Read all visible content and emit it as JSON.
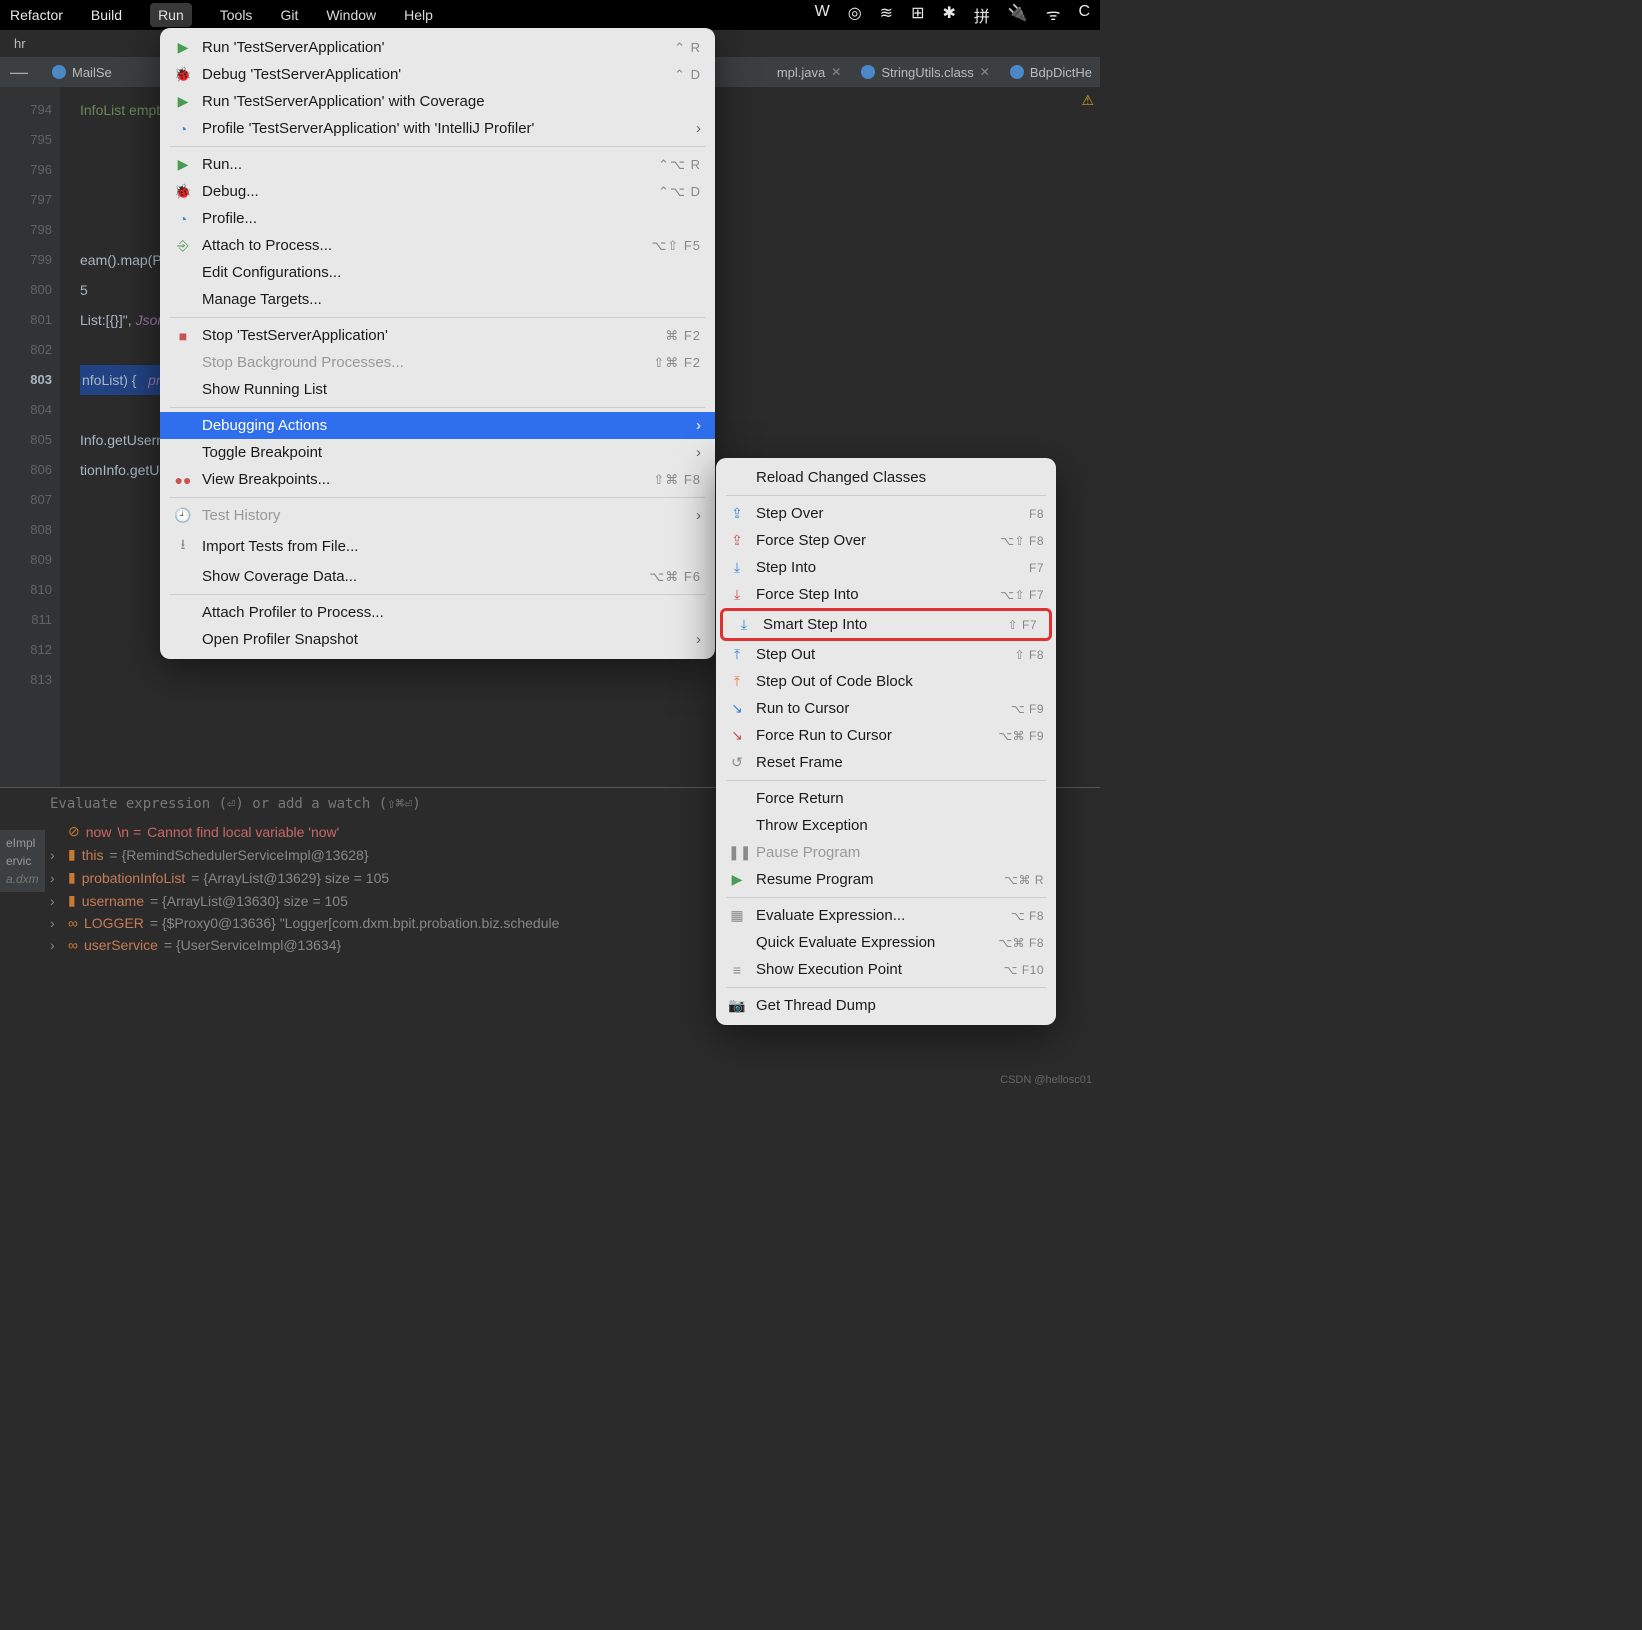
{
  "menubar": {
    "items": [
      "Refactor",
      "Build",
      "Run",
      "Tools",
      "Git",
      "Window",
      "Help"
    ],
    "active_index": 2,
    "tray": [
      "W",
      "◎",
      "≋",
      "⊞",
      "✱",
      "拼",
      "🔌",
      "ᯤ",
      "C"
    ]
  },
  "breadcrumb": "hr",
  "tabs": [
    {
      "label": "MailSe"
    },
    {
      "label": "mpl.java"
    },
    {
      "label": "StringUtils.class"
    },
    {
      "label": "BdpDictHe"
    }
  ],
  "gutter": {
    "start": 794,
    "end": 813,
    "breakpoint_line": 801,
    "current_line": 803
  },
  "code_lines": [
    "InfoList empty\");",
    "",
    "",
    "",
    "",
    "eam().map(ProbationInfo::getUsername",
    "5",
    "List:[{}]\", JsonUtil.toJson(username",
    "",
    "nfoList) {   probationInfoList:  siz",
    "",
    "Info.getUsername())) {",
    "tionInfo.getUsername());",
    "",
    "",
    "",
    "",
    "",
    "",
    ""
  ],
  "run_menu": [
    {
      "icon": "▶",
      "icon_cls": "ic-green",
      "label": "Run 'TestServerApplication'",
      "shortcut": "⌃ R"
    },
    {
      "icon": "🐞",
      "icon_cls": "ic-green",
      "label": "Debug 'TestServerApplication'",
      "shortcut": "⌃ D"
    },
    {
      "icon": "▶",
      "icon_cls": "ic-green",
      "label": "Run 'TestServerApplication' with Coverage",
      "shortcut": ""
    },
    {
      "icon": "◔",
      "icon_cls": "ic-blue",
      "label": "Profile 'TestServerApplication' with 'IntelliJ Profiler'",
      "shortcut": "",
      "arrow": true
    },
    {
      "sep": true
    },
    {
      "icon": "▶",
      "icon_cls": "ic-green",
      "label": "Run...",
      "shortcut": "⌃⌥ R"
    },
    {
      "icon": "🐞",
      "icon_cls": "ic-green",
      "label": "Debug...",
      "shortcut": "⌃⌥ D"
    },
    {
      "icon": "◔",
      "icon_cls": "ic-blue",
      "label": "Profile...",
      "shortcut": ""
    },
    {
      "icon": "⎆",
      "icon_cls": "ic-green",
      "label": "Attach to Process...",
      "shortcut": "⌥⇧ F5"
    },
    {
      "icon": "",
      "label": "Edit Configurations...",
      "shortcut": ""
    },
    {
      "icon": "",
      "label": "Manage Targets...",
      "shortcut": ""
    },
    {
      "sep": true
    },
    {
      "icon": "■",
      "icon_cls": "ic-red",
      "label": "Stop 'TestServerApplication'",
      "shortcut": "⌘ F2"
    },
    {
      "icon": "",
      "label": "Stop Background Processes...",
      "shortcut": "⇧⌘ F2",
      "disabled": true
    },
    {
      "icon": "",
      "label": "Show Running List",
      "shortcut": ""
    },
    {
      "sep": true
    },
    {
      "icon": "",
      "label": "Debugging Actions",
      "shortcut": "",
      "arrow": true,
      "selected": true
    },
    {
      "icon": "",
      "label": "Toggle Breakpoint",
      "shortcut": "",
      "arrow": true
    },
    {
      "icon": "●●",
      "icon_cls": "ic-red",
      "label": "View Breakpoints...",
      "shortcut": "⇧⌘ F8"
    },
    {
      "sep": true
    },
    {
      "icon": "🕘",
      "icon_cls": "ic-gray",
      "label": "Test History",
      "shortcut": "",
      "arrow": true,
      "disabled": true
    },
    {
      "icon": "⭳",
      "icon_cls": "ic-gray",
      "label": "Import Tests from File...",
      "shortcut": ""
    },
    {
      "icon": "",
      "label": "Show Coverage Data...",
      "shortcut": "⌥⌘ F6"
    },
    {
      "sep": true
    },
    {
      "icon": "",
      "label": "Attach Profiler to Process...",
      "shortcut": ""
    },
    {
      "icon": "",
      "label": "Open Profiler Snapshot",
      "shortcut": "",
      "arrow": true
    }
  ],
  "debug_submenu": [
    {
      "label": "Reload Changed Classes"
    },
    {
      "sep": true
    },
    {
      "icon": "⇪",
      "icon_cls": "ic-blue",
      "label": "Step Over",
      "shortcut": "F8"
    },
    {
      "icon": "⇪",
      "icon_cls": "ic-red",
      "label": "Force Step Over",
      "shortcut": "⌥⇧ F8"
    },
    {
      "icon": "⤓",
      "icon_cls": "ic-blue",
      "label": "Step Into",
      "shortcut": "F7"
    },
    {
      "icon": "⤓",
      "icon_cls": "ic-red",
      "label": "Force Step Into",
      "shortcut": "⌥⇧ F7"
    },
    {
      "icon": "⤓",
      "icon_cls": "ic-blue",
      "label": "Smart Step Into",
      "shortcut": "⇧ F7",
      "highlight": true
    },
    {
      "icon": "⤒",
      "icon_cls": "ic-blue",
      "label": "Step Out",
      "shortcut": "⇧ F8"
    },
    {
      "icon": "⤒",
      "icon_cls": "ic-orange",
      "label": "Step Out of Code Block",
      "shortcut": ""
    },
    {
      "icon": "↘",
      "icon_cls": "ic-blue",
      "label": "Run to Cursor",
      "shortcut": "⌥ F9"
    },
    {
      "icon": "↘",
      "icon_cls": "ic-red",
      "label": "Force Run to Cursor",
      "shortcut": "⌥⌘ F9"
    },
    {
      "icon": "↺",
      "icon_cls": "ic-gray",
      "label": "Reset Frame",
      "shortcut": ""
    },
    {
      "sep": true
    },
    {
      "label": "Force Return"
    },
    {
      "label": "Throw Exception"
    },
    {
      "icon": "❚❚",
      "icon_cls": "ic-gray",
      "label": "Pause Program",
      "disabled": true
    },
    {
      "icon": "▶",
      "icon_cls": "ic-green",
      "label": "Resume Program",
      "shortcut": "⌥⌘ R"
    },
    {
      "sep": true
    },
    {
      "icon": "▦",
      "icon_cls": "ic-gray",
      "label": "Evaluate Expression...",
      "shortcut": "⌥ F8"
    },
    {
      "label": "Quick Evaluate Expression",
      "shortcut": "⌥⌘ F8"
    },
    {
      "icon": "≡",
      "icon_cls": "ic-gray",
      "label": "Show Execution Point",
      "shortcut": "⌥ F10"
    },
    {
      "sep": true
    },
    {
      "icon": "📷",
      "icon_cls": "ic-gray",
      "label": "Get Thread Dump"
    }
  ],
  "vars": {
    "prompt": "Evaluate expression (⏎) or add a watch (⇧⌘⏎)",
    "rows": [
      {
        "expand": false,
        "icon": "⊘",
        "name": "now",
        "extra": "\\n = ",
        "err": "Cannot find local variable 'now'"
      },
      {
        "expand": true,
        "icon": "▮",
        "name": "this",
        "val": " = {RemindSchedulerServiceImpl@13628}"
      },
      {
        "expand": true,
        "icon": "▮",
        "name": "probationInfoList",
        "val": " = {ArrayList@13629}  size = 105"
      },
      {
        "expand": true,
        "icon": "▮",
        "name": "username",
        "val": " = {ArrayList@13630}  size = 105"
      },
      {
        "expand": true,
        "icon": "∞",
        "name": "LOGGER",
        "val": " = {$Proxy0@13636} \"Logger[com.dxm.bpit.probation.biz.schedule"
      },
      {
        "expand": true,
        "icon": "∞",
        "name": "userService",
        "val": " = {UserServiceImpl@13634}"
      }
    ]
  },
  "left_labels": [
    "eImpl",
    "ervic",
    "a.dxm"
  ],
  "watermark": "CSDN @hellosc01"
}
